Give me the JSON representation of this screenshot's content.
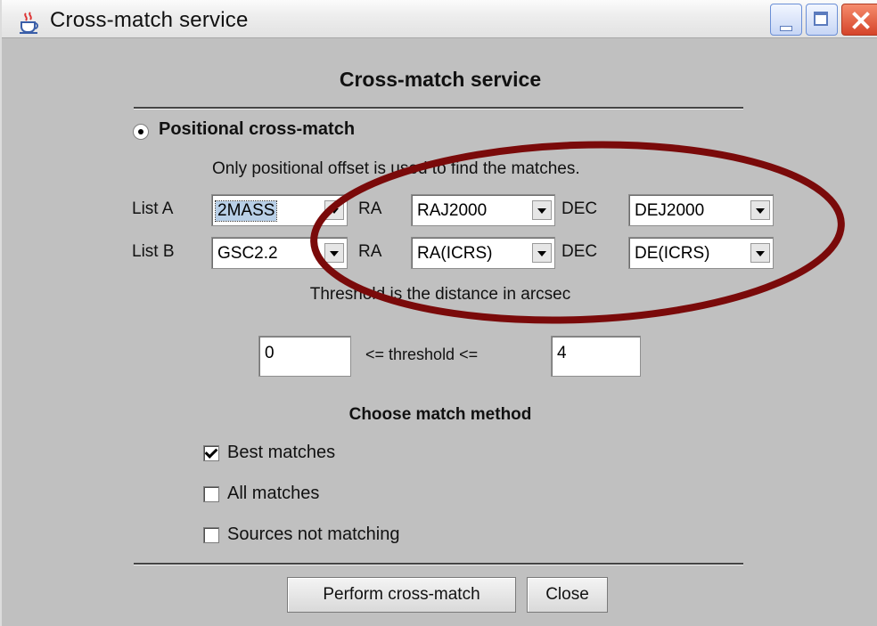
{
  "window": {
    "title": "Cross-match service"
  },
  "dialog": {
    "heading": "Cross-match service",
    "mode": {
      "label": "Positional cross-match",
      "selected": true
    },
    "description": "Only positional offset is used to find the matches.",
    "list_a": {
      "label": "List A",
      "catalog": "2MASS",
      "ra_label": "RA",
      "ra": "RAJ2000",
      "dec_label": "DEC",
      "dec": "DEJ2000"
    },
    "list_b": {
      "label": "List B",
      "catalog": "GSC2.2",
      "ra_label": "RA",
      "ra": "RA(ICRS)",
      "dec_label": "DEC",
      "dec": "DE(ICRS)"
    },
    "threshold_note": "Threshold is the distance in arcsec",
    "threshold": {
      "min": "0",
      "label": "<= threshold <=",
      "max": "4"
    },
    "method": {
      "title": "Choose match method",
      "options": [
        {
          "label": "Best matches",
          "checked": true
        },
        {
          "label": "All matches",
          "checked": false
        },
        {
          "label": "Sources not matching",
          "checked": false
        }
      ]
    },
    "buttons": {
      "perform": "Perform cross-match",
      "close": "Close"
    }
  },
  "colors": {
    "background": "#c0c0c0",
    "annotation_ellipse": "#7a0a0a",
    "selection": "#b8cfe7"
  },
  "icons": {
    "app": "java-cup-icon"
  }
}
